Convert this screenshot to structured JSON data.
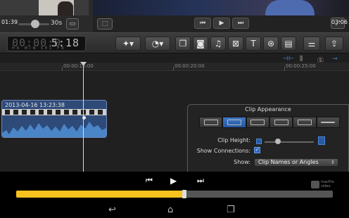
{
  "viewer": {
    "zoom_label": "30s",
    "timecode": "5:18",
    "timecode_dim": "00:00:0",
    "timecode_units": "HR MIN SEC FR"
  },
  "timeline": {
    "ruler_labels": [
      "00:00:15:00",
      "00:00:20:00",
      "00:00:25:00"
    ],
    "clip_title": "2013-04-16 13:23:38"
  },
  "clip_appearance": {
    "title": "Clip Appearance",
    "clip_height_label": "Clip Height:",
    "show_connections_label": "Show Connections:",
    "show_connections_checked": true,
    "show_label": "Show:",
    "show_value": "Clip Names or Angles",
    "selected_option_index": 1
  },
  "playback": {
    "current_time": "01:39",
    "total_time": "03:06",
    "progress_fraction": 0.53,
    "accent_color": "#f7c21d"
  },
  "watermark": {
    "line1": "macPro",
    "line2": "video"
  },
  "icons": {
    "magic_wand": "magic-wand-icon",
    "retime": "retime-icon",
    "camera": "camera-icon",
    "music": "music-icon",
    "title_tool": "T",
    "share": "share-icon"
  }
}
